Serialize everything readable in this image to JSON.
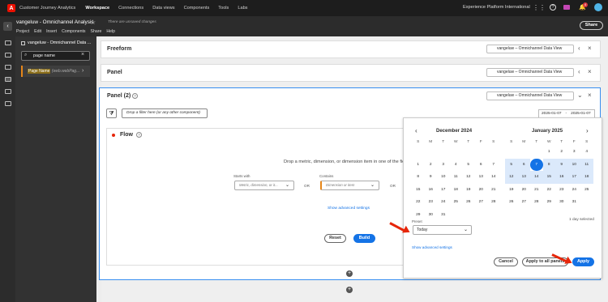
{
  "topbar": {
    "app_name": "Customer Journey Analytics",
    "nav": [
      "Workspace",
      "Connections",
      "Data views",
      "Components",
      "Tools",
      "Labs"
    ],
    "org": "Experience Platform International",
    "notification_count": "4"
  },
  "project": {
    "title": "vangeluw - Omnichannel Analysis",
    "unsaved": "There are unsaved changes",
    "menus": [
      "Project",
      "Edit",
      "Insert",
      "Components",
      "Share",
      "Help"
    ],
    "share_label": "Share"
  },
  "leftpanel": {
    "dataview_title": "vangeluw - Omnichannel Data ...",
    "search_value": "page name",
    "component_name": "Page Name",
    "component_sub": "(web.webPag..."
  },
  "panels": {
    "freeform": "Freeform",
    "panel": "Panel",
    "panel2": "Panel (2)",
    "dataview": "vangeluw – Omnichannel Data View",
    "filter_placeholder": "Drop a filter here (or any other component)",
    "date_start": "2025-01-07",
    "date_sep": "-",
    "date_end": "2025-01-07"
  },
  "flow": {
    "title": "Flow",
    "instruction": "Drop a metric, dimension, or dimension item in one of the fields",
    "starts_with_label": "Starts with",
    "starts_with_placeholder": "Metric, dimension, or it...",
    "or1": "OR",
    "contains_label": "Contains",
    "contains_placeholder": "Dimension or item",
    "or2": "OR",
    "show_advanced": "Show advanced settings",
    "reset": "Reset",
    "build": "Build"
  },
  "calendar": {
    "left_month": "December 2024",
    "right_month": "January 2025",
    "weekdays": [
      "S",
      "M",
      "T",
      "W",
      "T",
      "F",
      "S"
    ],
    "left_days": [
      "",
      "",
      "",
      "",
      "",
      "",
      "",
      "1",
      "2",
      "3",
      "4",
      "5",
      "6",
      "7",
      "8",
      "9",
      "10",
      "11",
      "12",
      "13",
      "14",
      "15",
      "16",
      "17",
      "18",
      "19",
      "20",
      "21",
      "22",
      "23",
      "24",
      "25",
      "26",
      "27",
      "28",
      "29",
      "30",
      "31",
      "",
      "",
      "",
      ""
    ],
    "right_days": [
      "",
      "",
      "",
      "1",
      "2",
      "3",
      "4",
      "5",
      "6",
      "7",
      "8",
      "9",
      "10",
      "11",
      "12",
      "13",
      "14",
      "15",
      "16",
      "17",
      "18",
      "19",
      "20",
      "21",
      "22",
      "23",
      "24",
      "25",
      "26",
      "27",
      "28",
      "29",
      "30",
      "31",
      ""
    ],
    "preset_label": "Preset",
    "preset_value": "Today",
    "days_selected": "1 day selected",
    "show_advanced": "Show advanced settings",
    "cancel": "Cancel",
    "apply_all": "Apply to all panels",
    "apply": "Apply"
  },
  "colors": {
    "accent": "#1473e6",
    "annotation": "#e6260a"
  }
}
